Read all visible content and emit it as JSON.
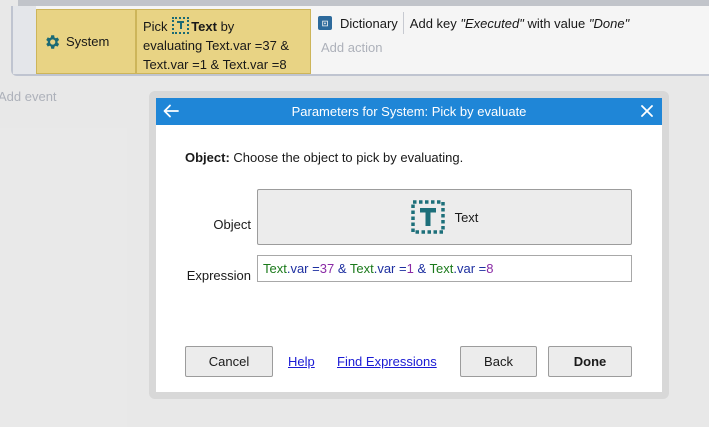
{
  "event_sheet": {
    "condition_object": "System",
    "condition_lines": [
      {
        "prefix": "Pick",
        "object": "Text",
        "suffix": "by"
      },
      {
        "text": "evaluating Text.var =37 &"
      },
      {
        "text": "Text.var =1 & Text.var =8"
      }
    ],
    "action": {
      "object": "Dictionary",
      "desc_prefix": "Add key ",
      "key": "\"Executed\"",
      "desc_mid": " with value ",
      "value": "\"Done\""
    },
    "add_action": "Add action",
    "add_event": "Add event",
    "icons": {
      "system": "gear-icon",
      "text": "text-object-icon",
      "dictionary": "dictionary-icon"
    }
  },
  "dialog": {
    "title": "Parameters for System: Pick by evaluate",
    "description_bold": "Object:",
    "description": " Choose the object to pick by evaluating.",
    "object_label": "Object",
    "object_value": "Text",
    "expression_label": "Expression",
    "expression_tokens": [
      {
        "t": "Text",
        "k": "obj"
      },
      {
        "t": ".var ",
        "k": "op"
      },
      {
        "t": "=",
        "k": "op"
      },
      {
        "t": "37",
        "k": "num"
      },
      {
        "t": " & ",
        "k": "op"
      },
      {
        "t": "Text",
        "k": "obj"
      },
      {
        "t": ".var ",
        "k": "op"
      },
      {
        "t": "=",
        "k": "op"
      },
      {
        "t": "1",
        "k": "num"
      },
      {
        "t": " & ",
        "k": "op"
      },
      {
        "t": "Text",
        "k": "obj"
      },
      {
        "t": ".var ",
        "k": "op"
      },
      {
        "t": "=",
        "k": "op"
      },
      {
        "t": "8",
        "k": "num"
      }
    ],
    "buttons": {
      "cancel": "Cancel",
      "help": "Help",
      "find": "Find Expressions",
      "back": "Back",
      "done": "Done"
    },
    "icons": {
      "back": "back-arrow-icon",
      "close": "close-icon",
      "object": "text-object-icon"
    },
    "colors": {
      "titlebar": "#1f86d7",
      "object_token": "#1b7a1b",
      "number_token": "#8a2aa5",
      "operator_token": "#1d2fa0",
      "link": "#1a1ad4"
    }
  }
}
